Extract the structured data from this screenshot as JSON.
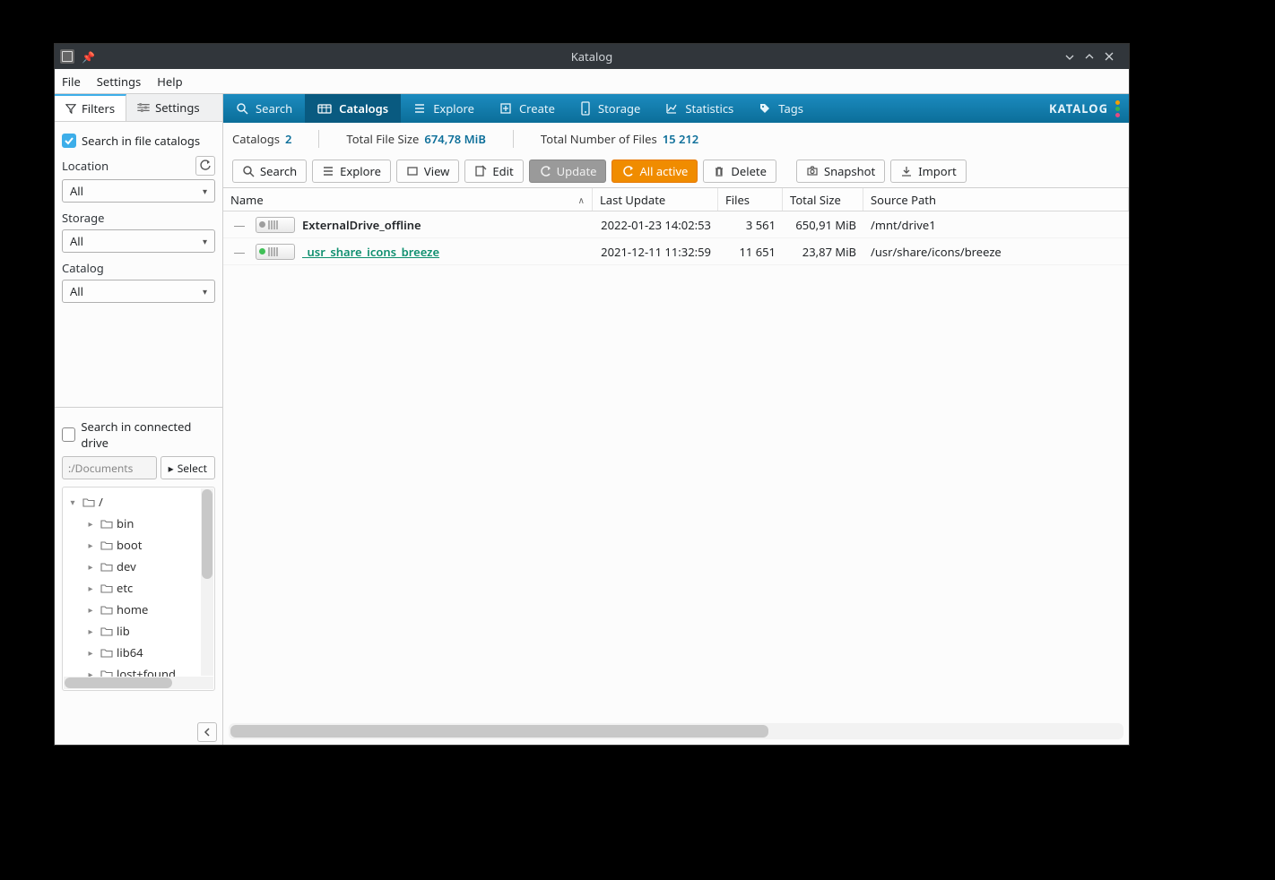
{
  "window": {
    "title": "Katalog",
    "brand": "KATALOG"
  },
  "menubar": [
    "File",
    "Settings",
    "Help"
  ],
  "side_tabs": {
    "filters": "Filters",
    "settings": "Settings"
  },
  "sidebar": {
    "search_in_catalogs": "Search in file catalogs",
    "location_label": "Location",
    "storage_label": "Storage",
    "catalog_label": "Catalog",
    "all": "All",
    "search_in_drive": "Search in connected drive",
    "docs_placeholder": ":/Documents",
    "select_button": "Select",
    "tree": [
      {
        "depth": 0,
        "expand": "▾",
        "name": "/"
      },
      {
        "depth": 1,
        "expand": "▸",
        "name": "bin"
      },
      {
        "depth": 1,
        "expand": "▸",
        "name": "boot"
      },
      {
        "depth": 1,
        "expand": "▸",
        "name": "dev"
      },
      {
        "depth": 1,
        "expand": "▸",
        "name": "etc"
      },
      {
        "depth": 1,
        "expand": "▸",
        "name": "home"
      },
      {
        "depth": 1,
        "expand": "▸",
        "name": "lib"
      },
      {
        "depth": 1,
        "expand": "▸",
        "name": "lib64"
      },
      {
        "depth": 1,
        "expand": "▸",
        "name": "lost+found"
      }
    ]
  },
  "nav": [
    {
      "label": "Search"
    },
    {
      "label": "Catalogs"
    },
    {
      "label": "Explore"
    },
    {
      "label": "Create"
    },
    {
      "label": "Storage"
    },
    {
      "label": "Statistics"
    },
    {
      "label": "Tags"
    }
  ],
  "stats": {
    "catalogs_label": "Catalogs",
    "catalogs_value": "2",
    "size_label": "Total File Size",
    "size_value": "674,78 MiB",
    "count_label": "Total Number of Files",
    "count_value": "15 212"
  },
  "toolbar": {
    "search": "Search",
    "explore": "Explore",
    "view": "View",
    "edit": "Edit",
    "update": "Update",
    "all_active": "All active",
    "delete": "Delete",
    "snapshot": "Snapshot",
    "import": "Import"
  },
  "table": {
    "headers": {
      "name": "Name",
      "last": "Last Update",
      "files": "Files",
      "size": "Total Size",
      "path": "Source Path"
    },
    "rows": [
      {
        "status": "off",
        "name": "ExternalDrive_offline",
        "last": "2022-01-23 14:02:53",
        "files": "3 561",
        "size": "650,91 MiB",
        "path": "/mnt/drive1"
      },
      {
        "status": "on",
        "name": "_usr_share_icons_breeze",
        "last": "2021-12-11 11:32:59",
        "files": "11 651",
        "size": "23,87 MiB",
        "path": "/usr/share/icons/breeze"
      }
    ]
  }
}
